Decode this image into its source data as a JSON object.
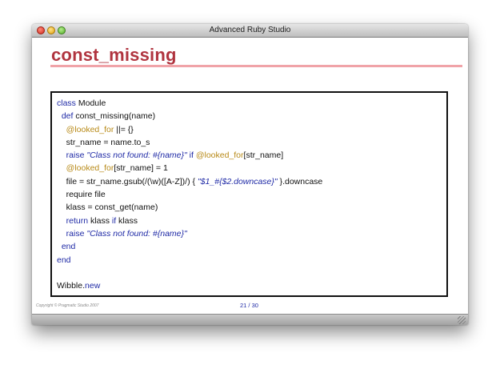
{
  "window": {
    "title": "Advanced Ruby Studio",
    "controls": {
      "close": "close-button",
      "minimize": "minimize-button",
      "zoom": "zoom-button"
    }
  },
  "slide": {
    "title": "const_missing",
    "code_lines": [
      [
        {
          "t": "class",
          "c": "kw"
        },
        {
          "t": " Module",
          "c": ""
        }
      ],
      [
        {
          "t": "  def",
          "c": "kw"
        },
        {
          "t": " const_missing(name)",
          "c": ""
        }
      ],
      [
        {
          "t": "    @looked_for",
          "c": "ivar"
        },
        {
          "t": " ||= {}",
          "c": ""
        }
      ],
      [
        {
          "t": "    str_name = name.to_s",
          "c": ""
        }
      ],
      [
        {
          "t": "    raise ",
          "c": "kw"
        },
        {
          "t": "\"Class not found: #{",
          "c": "str"
        },
        {
          "t": "name",
          "c": "interp"
        },
        {
          "t": "}\"",
          "c": "str"
        },
        {
          "t": " if ",
          "c": "kw"
        },
        {
          "t": "@looked_for",
          "c": "ivar"
        },
        {
          "t": "[str_name]",
          "c": ""
        }
      ],
      [
        {
          "t": "    @looked_for",
          "c": "ivar"
        },
        {
          "t": "[str_name] = 1",
          "c": ""
        }
      ],
      [
        {
          "t": "    file = str_name.gsub(/(\\w)([A-Z])/) { ",
          "c": ""
        },
        {
          "t": "\"$1_#{$2.downcase}\"",
          "c": "str"
        },
        {
          "t": " }.downcase",
          "c": ""
        }
      ],
      [
        {
          "t": "    require file",
          "c": ""
        }
      ],
      [
        {
          "t": "    klass = const_get(name)",
          "c": ""
        }
      ],
      [
        {
          "t": "    return",
          "c": "kw"
        },
        {
          "t": " klass ",
          "c": ""
        },
        {
          "t": "if",
          "c": "kw"
        },
        {
          "t": " klass",
          "c": ""
        }
      ],
      [
        {
          "t": "    raise ",
          "c": "kw"
        },
        {
          "t": "\"Class not found: #{",
          "c": "str"
        },
        {
          "t": "name",
          "c": "interp"
        },
        {
          "t": "}\"",
          "c": "str"
        }
      ],
      [
        {
          "t": "  end",
          "c": "kw"
        }
      ],
      [
        {
          "t": "end",
          "c": "kw"
        }
      ],
      [
        {
          "t": "",
          "c": ""
        }
      ],
      [
        {
          "t": "Wibble.",
          "c": ""
        },
        {
          "t": "new",
          "c": "kw"
        }
      ]
    ]
  },
  "footer": {
    "copyright": "Copyright © Pragmatic Studio 2007",
    "page": "21 / 30"
  },
  "colors": {
    "title": "#b0343f",
    "rule": "#f0a3a8",
    "keyword": "#1f2aa6",
    "ivar": "#b88a18"
  }
}
